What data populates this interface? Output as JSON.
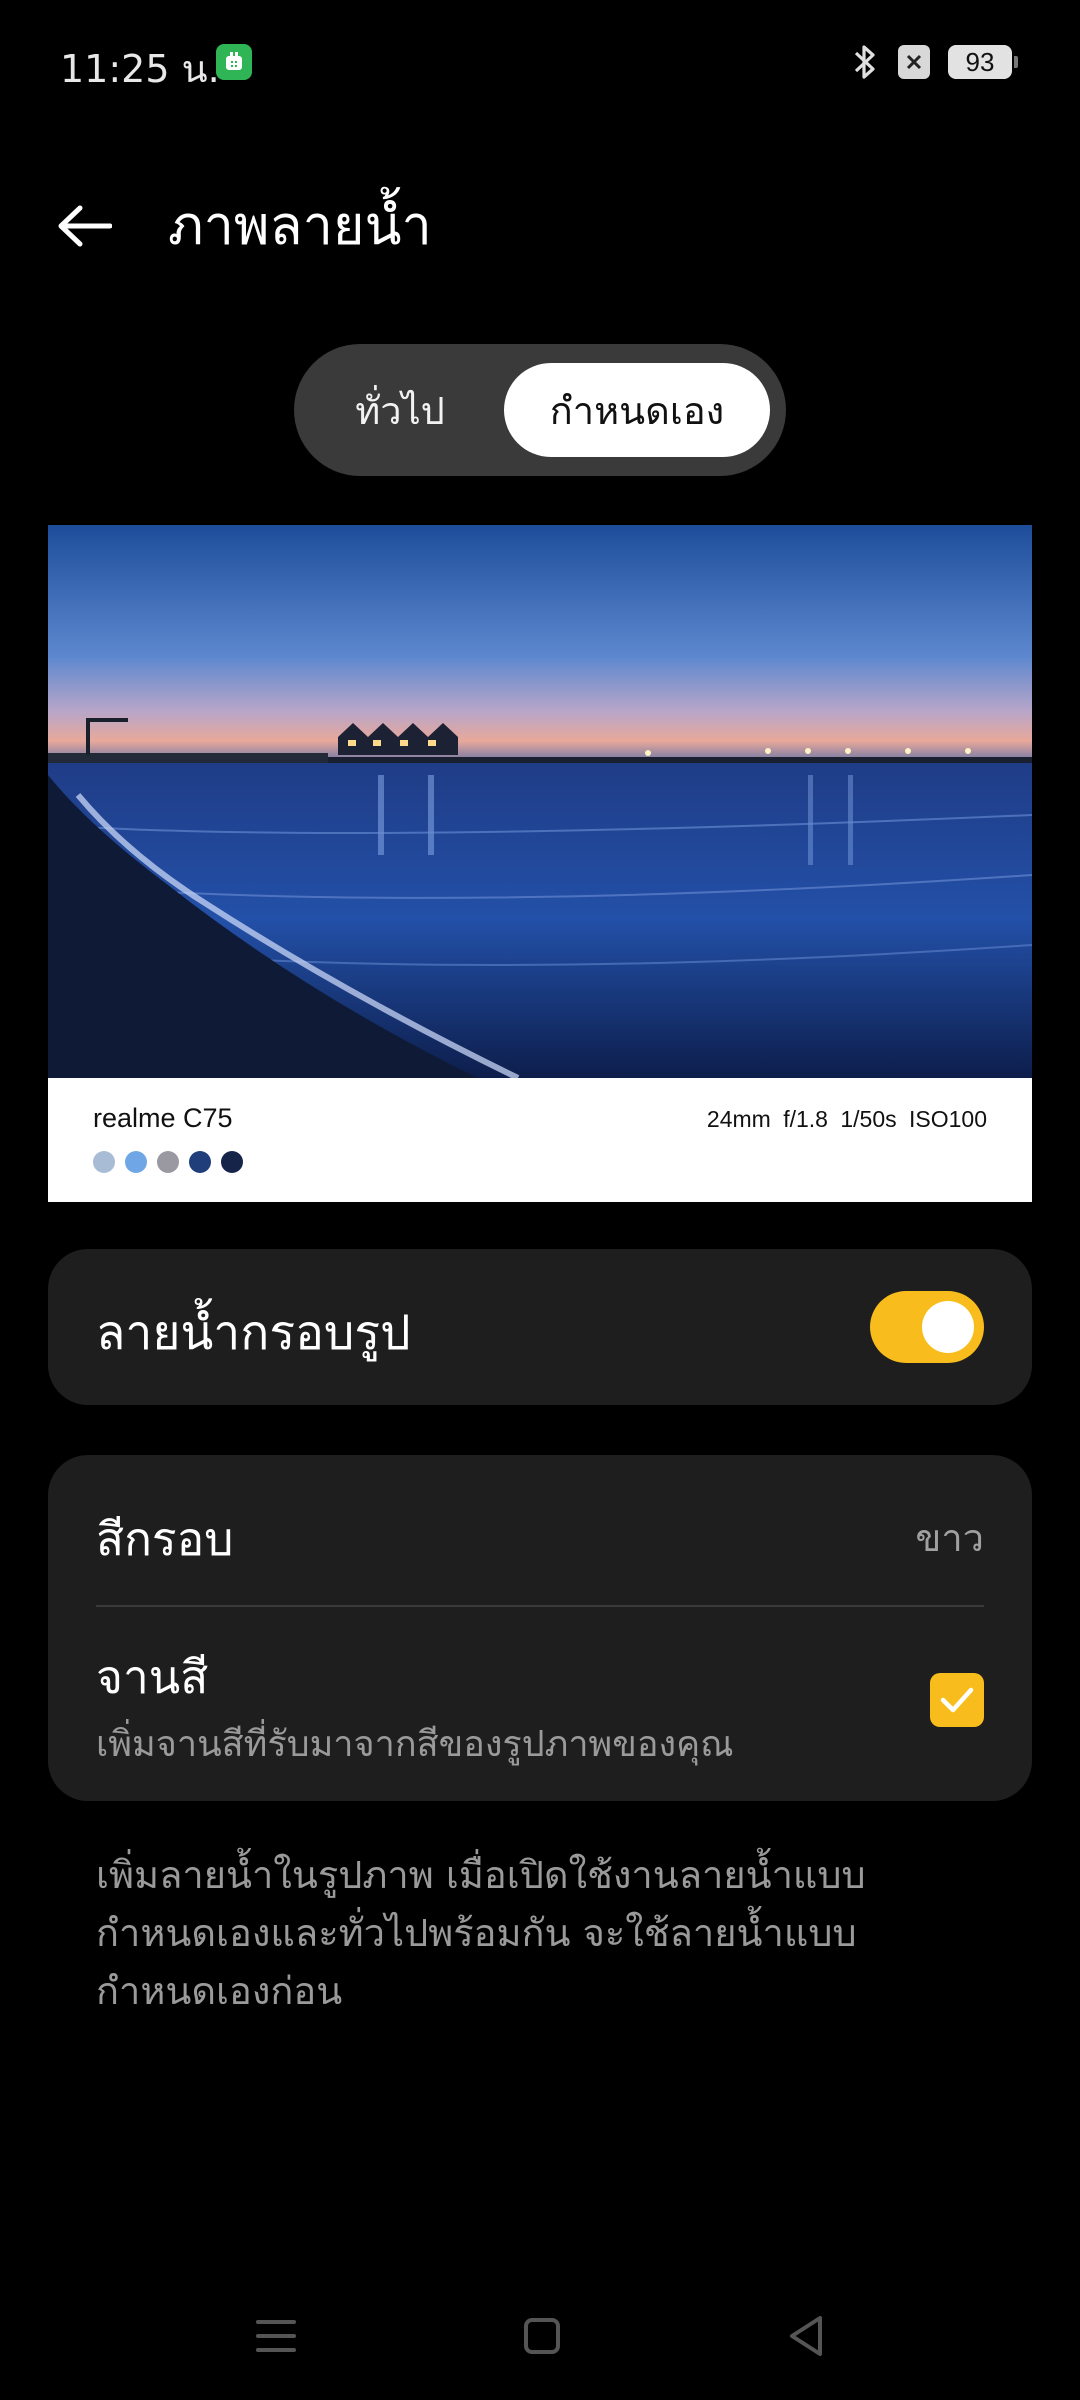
{
  "status_bar": {
    "time": "11:25 น.",
    "battery": "93",
    "icons": [
      "app-notification-icon",
      "bluetooth-icon",
      "no-signal-icon",
      "battery-icon"
    ]
  },
  "header": {
    "title": "ภาพลายน้ำ",
    "back_icon": "back-arrow-icon"
  },
  "segmented": {
    "options": [
      "ทั่วไป",
      "กำหนดเอง"
    ],
    "selected": "กำหนดเอง"
  },
  "preview": {
    "device": "realme C75",
    "exif": "24mm f/1.8 1/50s ISO100",
    "palette_colors": [
      "#a9bcd6",
      "#6fa7e6",
      "#9a99a1",
      "#1f3e7a",
      "#17244a"
    ]
  },
  "frame_watermark": {
    "label": "ลายน้ำกรอบรูป",
    "enabled": true,
    "accent": "#f8bd1c"
  },
  "options": {
    "frame_color_label": "สีกรอบ",
    "frame_color_value": "ขาว",
    "palette_label": "จานสี",
    "palette_desc": "เพิ่มจานสีที่รับมาจากสีของรูปภาพของคุณ",
    "palette_checked": true
  },
  "footnote": "เพิ่มลายน้ำในรูปภาพ เมื่อเปิดใช้งานลายน้ำแบบกำหนดเองและทั่วไปพร้อมกัน จะใช้ลายน้ำแบบกำหนดเองก่อน",
  "nav_bar": {
    "icons": [
      "menu-icon",
      "home-icon",
      "back-triangle-icon"
    ]
  }
}
